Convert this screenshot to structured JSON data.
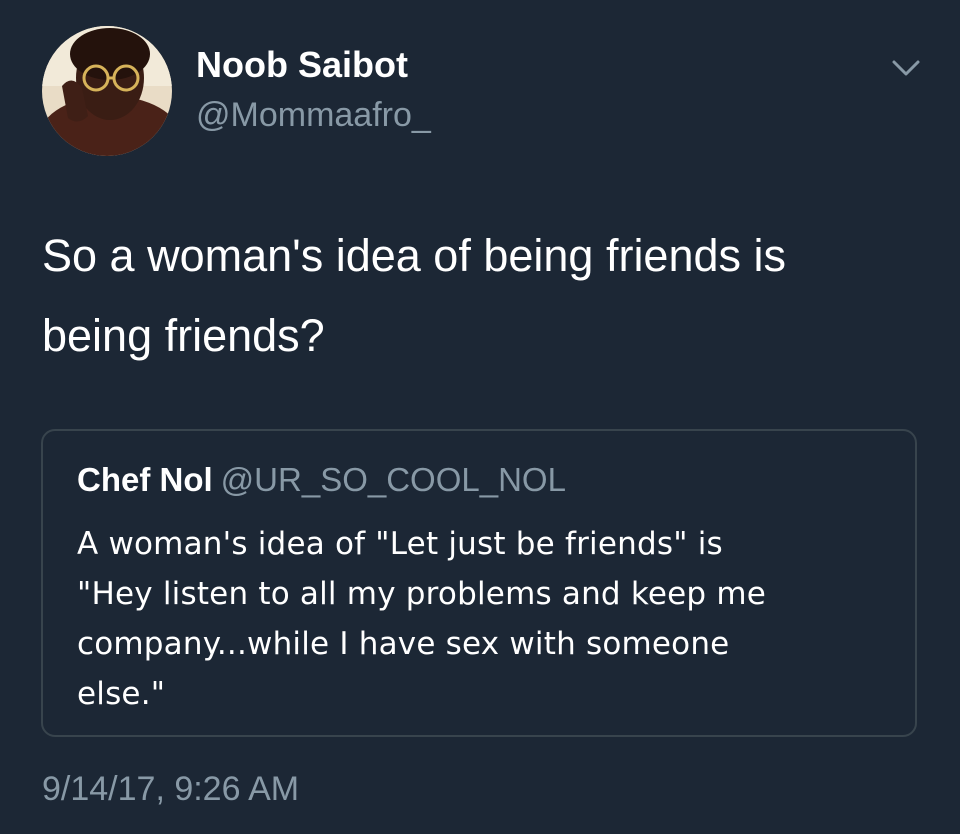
{
  "tweet": {
    "author": {
      "display_name": "Noob Saibot",
      "handle": "@Mommaafro_",
      "avatar": "avatar-photo"
    },
    "menu_icon": "chevron-down-icon",
    "text_lines": [
      "So a woman's idea of being friends is",
      "being friends?"
    ],
    "timestamp": "9/14/17, 9:26 AM"
  },
  "quoted_tweet": {
    "author_name": "Chef Nol",
    "author_handle": "@UR_SO_COOL_NOL",
    "text_lines": [
      "A woman's idea of \"Let just be friends\" is",
      "\"Hey listen to all my problems and keep me",
      "company...while I have sex with someone",
      "else.\""
    ]
  },
  "colors": {
    "background": "#1c2735",
    "primary_text": "#ffffff",
    "secondary_text": "#8899a6",
    "card_border": "#38444d"
  }
}
